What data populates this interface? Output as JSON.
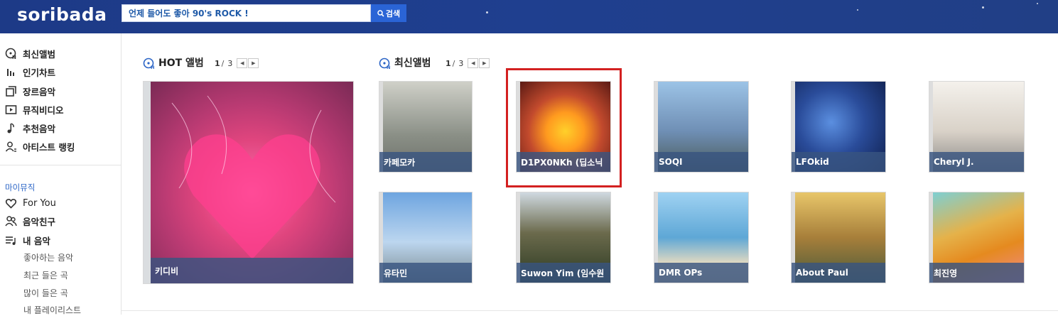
{
  "header": {
    "logo": "soribada",
    "search_placeholder": "언제 들어도 좋아 90's ROCK !",
    "search_button": "검색"
  },
  "sidebar": {
    "main_items": [
      {
        "label": "최신앨범",
        "icon": "new-album-icon"
      },
      {
        "label": "인기차트",
        "icon": "chart-bars-icon"
      },
      {
        "label": "장르음악",
        "icon": "genre-icon"
      },
      {
        "label": "뮤직비디오",
        "icon": "video-icon"
      },
      {
        "label": "추천음악",
        "icon": "note-icon"
      },
      {
        "label": "아티스트 랭킹",
        "icon": "artist-icon"
      }
    ],
    "section_title": "마이뮤직",
    "my_items": [
      {
        "label": "For You",
        "icon": "heart-icon"
      },
      {
        "label": "음악친구",
        "icon": "friends-icon"
      },
      {
        "label": "내 음악",
        "icon": "playlist-icon"
      }
    ],
    "sub_items": [
      "좋아하는 음악",
      "최근 들은 곡",
      "많이 들은 곡",
      "내 플레이리스트"
    ]
  },
  "hot": {
    "title": "HOT 앨범",
    "page_current": "1",
    "page_total": "3",
    "card": {
      "label": "키디비",
      "color": "#e0457e"
    }
  },
  "latest": {
    "title": "최신앨범",
    "page_current": "1",
    "page_total": "3",
    "cards": [
      {
        "label": "카페모카",
        "color": "#8a8f86"
      },
      {
        "label": "D1PX0NKh (딥소닉",
        "color": "#c24a2d"
      },
      {
        "label": "SOQI",
        "color": "#6f8fb5"
      },
      {
        "label": "LFOkid",
        "color": "#2a4c9a"
      },
      {
        "label": "Cheryl J.",
        "color": "#d9d2c8"
      },
      {
        "label": "유타민",
        "color": "#6ea5e0"
      },
      {
        "label": "Suwon Yim (임수원",
        "color": "#6b6a4c"
      },
      {
        "label": "DMR OPs",
        "color": "#5ea7d6"
      },
      {
        "label": "About Paul",
        "color": "#a77f3a"
      },
      {
        "label": "최진영",
        "color": "#e58a1f"
      }
    ]
  }
}
